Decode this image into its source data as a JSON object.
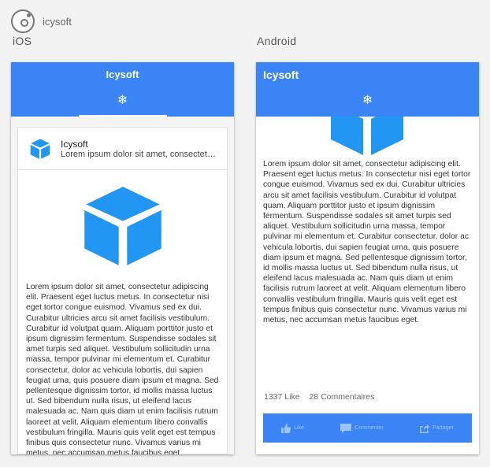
{
  "brand": {
    "name": "icysoft"
  },
  "platforms": {
    "ios": "iOS",
    "android": "Android"
  },
  "app": {
    "title": "Icysoft",
    "tab_icon": "❄"
  },
  "card": {
    "title": "Icysoft",
    "subtitle": "Lorem ipsum dolor sit amet, consectetur adipiscing elit.",
    "body": "Lorem ipsum dolor sit amet, consectetur adipiscing elit. Praesent eget luctus metus. In consectetur nisi eget tortor congue euismod. Vivamus sed ex dui. Curabitur ultricies arcu sit amet facilisis vestibulum. Curabitur id volutpat quam. Aliquam porttitor justo et ipsum dignissim fermentum. Suspendisse sodales sit amet turpis sed aliquet. Vestibulum sollicitudin urna massa, tempor pulvinar mi elementum et. Curabitur consectetur, dolor ac vehicula lobortis, dui sapien feugiat urna, quis posuere diam ipsum et magna. Sed pellentesque dignissim tortor, id mollis massa luctus ut. Sed bibendum nulla risus, ut eleifend lacus malesuada ac. Nam quis diam ut enim facilisis rutrum laoreet at velit. Aliquam elementum libero convallis vestibulum fringilla. Mauris quis velit eget est tempus finibus quis consectetur nunc. Vivamus varius mi metus, nec accumsan metus faucibus eget."
  },
  "stats": {
    "likes": "1337 Like",
    "comments": "28 Commentaires"
  },
  "actions": {
    "like": "Like",
    "comment": "Commenter",
    "share": "Partager"
  },
  "colors": {
    "primary": "#3b84f5",
    "cube": "#2196f3"
  },
  "icons": {
    "tab": "snowflake-icon",
    "like": "thumb-up-icon",
    "comment": "comment-icon",
    "share": "share-icon"
  }
}
